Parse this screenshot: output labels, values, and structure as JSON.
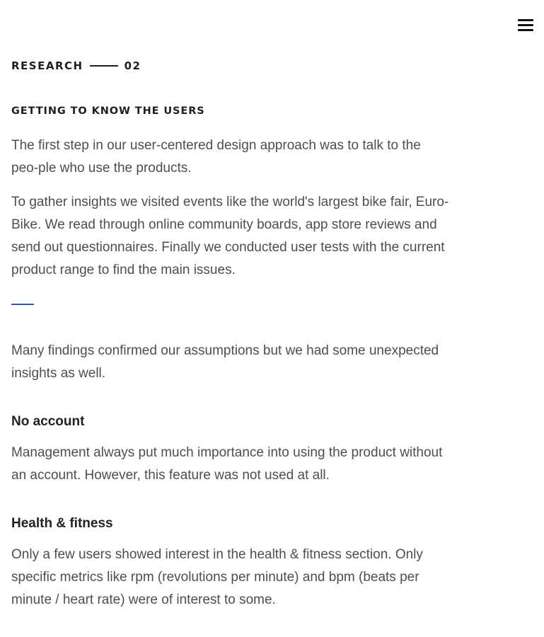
{
  "header": {
    "menu_icon": "hamburger-menu-icon"
  },
  "section": {
    "label": "RESEARCH",
    "number": "02"
  },
  "heading": "GETTING TO KNOW THE USERS",
  "paragraphs": {
    "intro": "The first step in our user-centered design approach was to talk to the peo-ple who use the products.",
    "insights": "To gather insights we visited events like the world's largest bike fair, Euro-Bike. We read through online community boards, app store reviews and send out questionnaires. Finally we conducted user tests with the current product range to find the main issues.",
    "findings": "Many findings confirmed our assumptions but we had some unexpected insights as well."
  },
  "findings": [
    {
      "title": "No account",
      "text": "Management always put much importance into using the product without an account. However, this feature was not used at all."
    },
    {
      "title": "Health & fitness",
      "text": "Only a few users showed interest in the health & fitness section. Only specific metrics like rpm (revolutions per minute) and bpm (beats per minute / heart rate) were of interest to some."
    }
  ],
  "colors": {
    "accent": "#2f55b8",
    "text": "#4e4e4e",
    "heading": "#1f1f1f"
  }
}
